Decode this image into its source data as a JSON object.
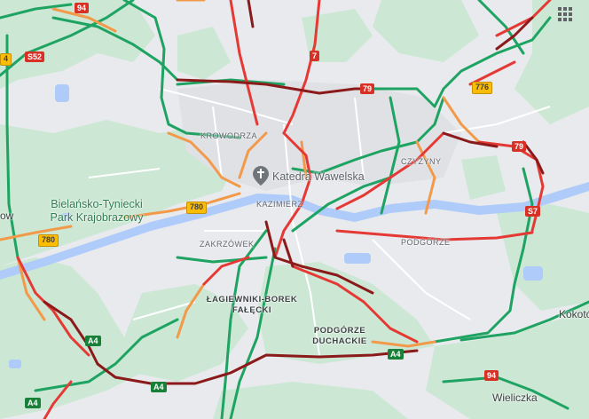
{
  "map": {
    "labels": {
      "krowodrza": "KROWODRZA",
      "kazimierz": "KAZIMIERZ",
      "zakrzowek": "ZAKRZÓWEK",
      "podgorze": "PODGÓRZE",
      "czyzyny": "CZYŻYNY",
      "lagiewniki_line1": "ŁAGIEWNIKI-BOREK",
      "lagiewniki_line2": "FAŁĘCKI",
      "podgorze_duchackie_line1": "PODGÓRZE",
      "podgorze_duchackie_line2": "DUCHACKIE",
      "park_line1": "Bielańsko-Tyniecki",
      "park_line2": "Park Krajobrazowy",
      "wieliczka": "Wieliczka",
      "kokotow": "Kokotó",
      "left_edge": "ow"
    },
    "poi": {
      "name": "Katedra Wawelska",
      "icon": "cross-church-icon"
    },
    "road_shields": {
      "s52": "S52",
      "r94_top": "94",
      "r7": "7",
      "r79_a": "79",
      "r79_b": "79",
      "r776": "776",
      "s7": "S7",
      "r780_a": "780",
      "r780_b": "780",
      "a4_a": "A4",
      "a4_b": "A4",
      "a4_c": "A4",
      "a4_d": "A4",
      "r94_bottom": "94",
      "edge_4": "4"
    },
    "traffic_colors": {
      "fast": "#1ea362",
      "slow": "#f2994a",
      "jam": "#e53935",
      "heavy": "#8b1a1a"
    },
    "controls": {
      "layers_icon": "grid-apps-icon"
    }
  }
}
